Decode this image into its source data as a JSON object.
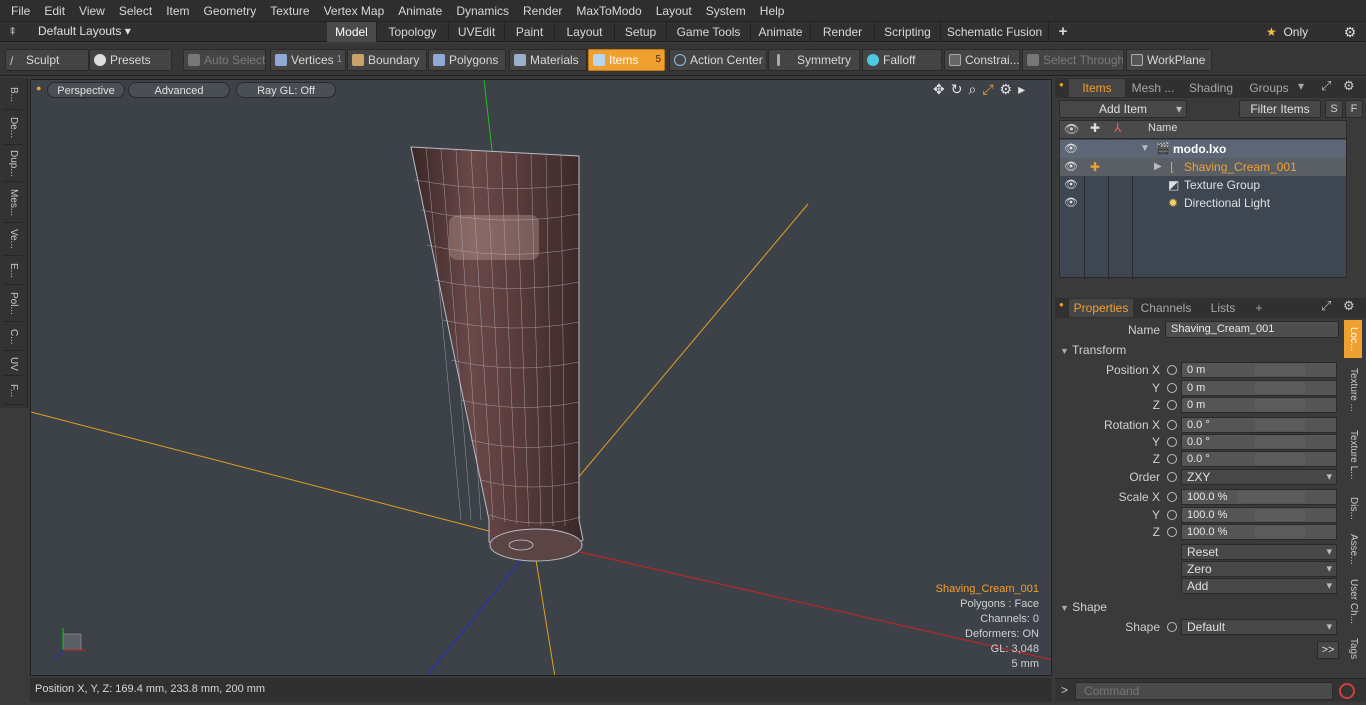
{
  "menu": [
    "File",
    "Edit",
    "View",
    "Select",
    "Item",
    "Geometry",
    "Texture",
    "Vertex Map",
    "Animate",
    "Dynamics",
    "Render",
    "MaxToModo",
    "Layout",
    "System",
    "Help"
  ],
  "layouts": {
    "label": "Default Layouts"
  },
  "tabs": [
    "Model",
    "Topology",
    "UVEdit",
    "Paint",
    "Layout",
    "Setup",
    "Game Tools",
    "Animate",
    "Render",
    "Scripting",
    "Schematic Fusion"
  ],
  "tab_add": "+",
  "only_label": "Only",
  "toolbar": {
    "sculpt": "Sculpt",
    "presets": "Presets",
    "auto_select": "Auto Select",
    "vertices": "Vertices",
    "vertices_count": "1",
    "boundary": "Boundary",
    "polygons": "Polygons",
    "materials": "Materials",
    "items": "Items",
    "items_count": "5",
    "action_center": "Action Center",
    "symmetry": "Symmetry",
    "falloff": "Falloff",
    "constraints": "Constrai...",
    "select_through": "Select Through",
    "workplane": "WorkPlane"
  },
  "left_tools": [
    "B...",
    "De...",
    "Dup...",
    "Mes...",
    "Ve...",
    "E...",
    "Pol...",
    "C...",
    "UV",
    "F..."
  ],
  "viewport": {
    "perspective": "Perspective",
    "advanced": "Advanced",
    "raygl": "Ray GL: Off",
    "info": {
      "name": "Shaving_Cream_001",
      "polygons": "Polygons : Face",
      "channels": "Channels: 0",
      "deformers": "Deformers: ON",
      "gl": "GL: 3,048",
      "scale": "5 mm"
    }
  },
  "status": "Position X, Y, Z:   169.4 mm, 233.8 mm, 200 mm",
  "items_panel": {
    "tabs": [
      "Items",
      "Mesh ...",
      "Shading",
      "Groups"
    ],
    "add_item": "Add Item",
    "filter": "Filter Items",
    "s": "S",
    "f": "F",
    "col_name": "Name",
    "rows": [
      "modo.lxo",
      "Shaving_Cream_001",
      "Texture Group",
      "Directional Light"
    ]
  },
  "properties": {
    "tabs": [
      "Properties",
      "Channels",
      "Lists"
    ],
    "tab_add": "+",
    "name_label": "Name",
    "name_value": "Shaving_Cream_001",
    "transform": "Transform",
    "position_label": "Position X",
    "rotation_label": "Rotation X",
    "scale_label": "Scale X",
    "y": "Y",
    "z": "Z",
    "pos": [
      "0 m",
      "0 m",
      "0 m"
    ],
    "rot": [
      "0.0 °",
      "0.0 °",
      "0.0 °"
    ],
    "order_label": "Order",
    "order": "ZXY",
    "scale": [
      "100.0 %",
      "100.0 %",
      "100.0 %"
    ],
    "reset": "Reset",
    "zero": "Zero",
    "add": "Add",
    "shape_section": "Shape",
    "shape_label": "Shape",
    "shape_value": "Default",
    "more": ">>",
    "side_tabs": [
      "Loc...",
      "Texture ...",
      "Texture L...",
      "Dis...",
      "Asse...",
      "User Ch...",
      "Tags"
    ]
  },
  "command": {
    "prompt": ">",
    "placeholder": "Command"
  }
}
